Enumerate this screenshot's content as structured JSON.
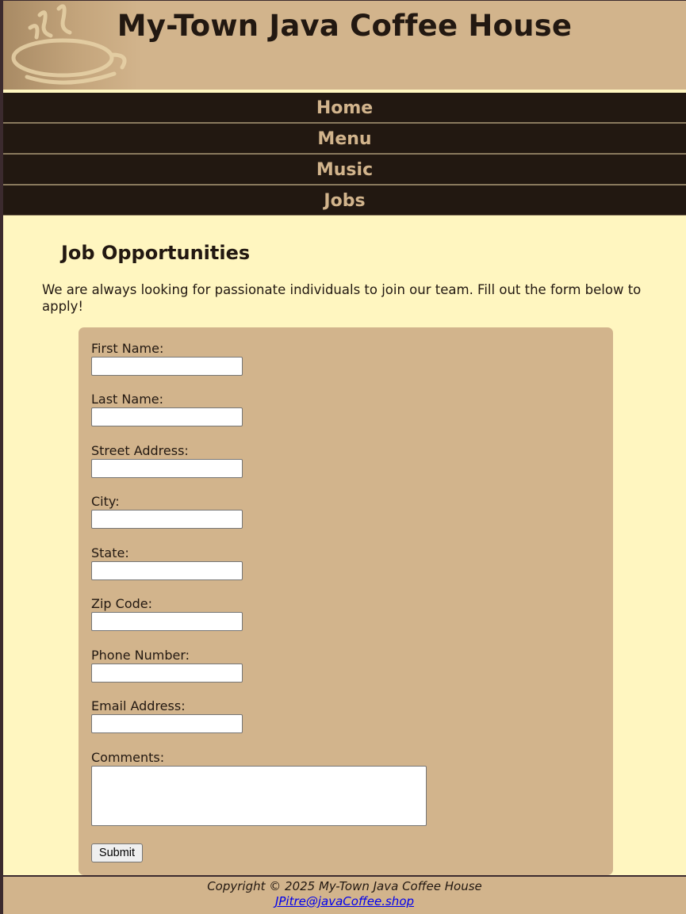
{
  "header": {
    "title": "My-Town Java Coffee House",
    "logo_icon": "coffee-cup-icon"
  },
  "nav": {
    "items": [
      {
        "label": "Home"
      },
      {
        "label": "Menu"
      },
      {
        "label": "Music"
      },
      {
        "label": "Jobs"
      }
    ]
  },
  "main": {
    "heading": "Job Opportunities",
    "intro": "We are always looking for passionate individuals to join our team. Fill out the form below to apply!"
  },
  "form": {
    "fields": [
      {
        "label": "First Name:",
        "value": ""
      },
      {
        "label": "Last Name:",
        "value": ""
      },
      {
        "label": "Street Address:",
        "value": ""
      },
      {
        "label": "City:",
        "value": ""
      },
      {
        "label": "State:",
        "value": ""
      },
      {
        "label": "Zip Code:",
        "value": ""
      },
      {
        "label": "Phone Number:",
        "value": ""
      },
      {
        "label": "Email Address:",
        "value": ""
      }
    ],
    "comments": {
      "label": "Comments:",
      "value": ""
    },
    "submit_label": "Submit"
  },
  "footer": {
    "copyright": "Copyright © 2025 My-Town Java Coffee House",
    "email": "JPitre@javaCoffee.shop"
  },
  "colors": {
    "page_bg": "#fff6c0",
    "tan": "#d2b48c",
    "dark_brown": "#221811",
    "frame": "#3b2a2e",
    "link": "#0000ee"
  }
}
